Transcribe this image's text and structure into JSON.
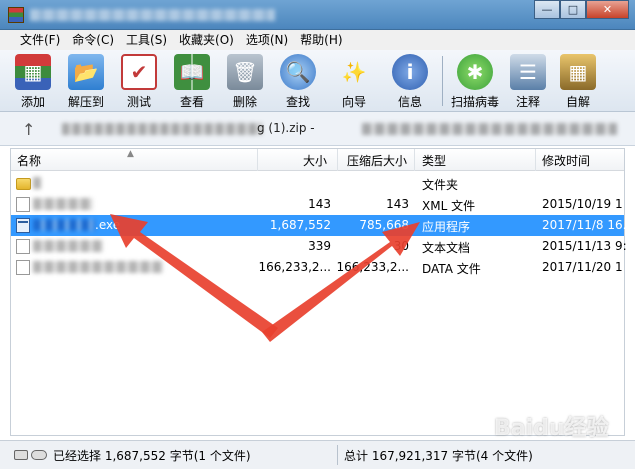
{
  "menu": [
    "文件(F)",
    "命令(C)",
    "工具(S)",
    "收藏夹(O)",
    "选项(N)",
    "帮助(H)"
  ],
  "toolbar": [
    {
      "label": "添加",
      "icon": "add-archive-icon",
      "color": "#b83232"
    },
    {
      "label": "解压到",
      "icon": "extract-folder-icon",
      "color": "#2f7fd1"
    },
    {
      "label": "测试",
      "icon": "test-checklist-icon",
      "color": "#c23a3a"
    },
    {
      "label": "查看",
      "icon": "view-book-icon",
      "color": "#3f8f3f"
    },
    {
      "label": "删除",
      "icon": "delete-trash-icon",
      "color": "#7a8a9a"
    },
    {
      "label": "查找",
      "icon": "find-magnifier-icon",
      "color": "#3a78c8"
    },
    {
      "label": "向导",
      "icon": "wizard-wand-icon",
      "color": "#3c6fb3"
    },
    {
      "label": "信息",
      "icon": "info-icon",
      "color": "#2f5fb0"
    },
    {
      "label": "扫描病毒",
      "icon": "scan-virus-bug-icon",
      "color": "#3aa03a"
    },
    {
      "label": "注释",
      "icon": "comment-icon",
      "color": "#5a7fa8"
    },
    {
      "label": "自解",
      "icon": "self-extract-icon",
      "color": "#8a6a2a"
    }
  ],
  "address": {
    "visible_text": "g (1).zip -"
  },
  "columns": {
    "name": "名称",
    "size": "大小",
    "packed": "压缩后大小",
    "type": "类型",
    "modified": "修改时间"
  },
  "files": [
    {
      "name": "",
      "size": "",
      "packed": "",
      "type": "文件夹",
      "modified": "",
      "icon": "folder-icon"
    },
    {
      "name": "",
      "size": "143",
      "packed": "143",
      "type": "XML 文件",
      "modified": "2015/10/19 1",
      "icon": "document-icon"
    },
    {
      "name": ".exe",
      "size": "1,687,552",
      "packed": "785,668",
      "type": "应用程序",
      "modified": "2017/11/8 16..",
      "icon": "exe-icon",
      "selected": true
    },
    {
      "name": "",
      "size": "339",
      "packed": "30",
      "type": "文本文档",
      "modified": "2015/11/13 9:",
      "icon": "document-icon"
    },
    {
      "name": "",
      "size": "166,233,2...",
      "packed": "166,233,2...",
      "type": "DATA 文件",
      "modified": "2017/11/20 1",
      "icon": "document-icon"
    }
  ],
  "status": {
    "selected": "已经选择 1,687,552 字节(1 个文件)",
    "total": "总计 167,921,317 字节(4 个文件)"
  },
  "watermark": "Baidu经验",
  "colors": {
    "selection": "#3399ff",
    "arrow": "#e8402e"
  }
}
